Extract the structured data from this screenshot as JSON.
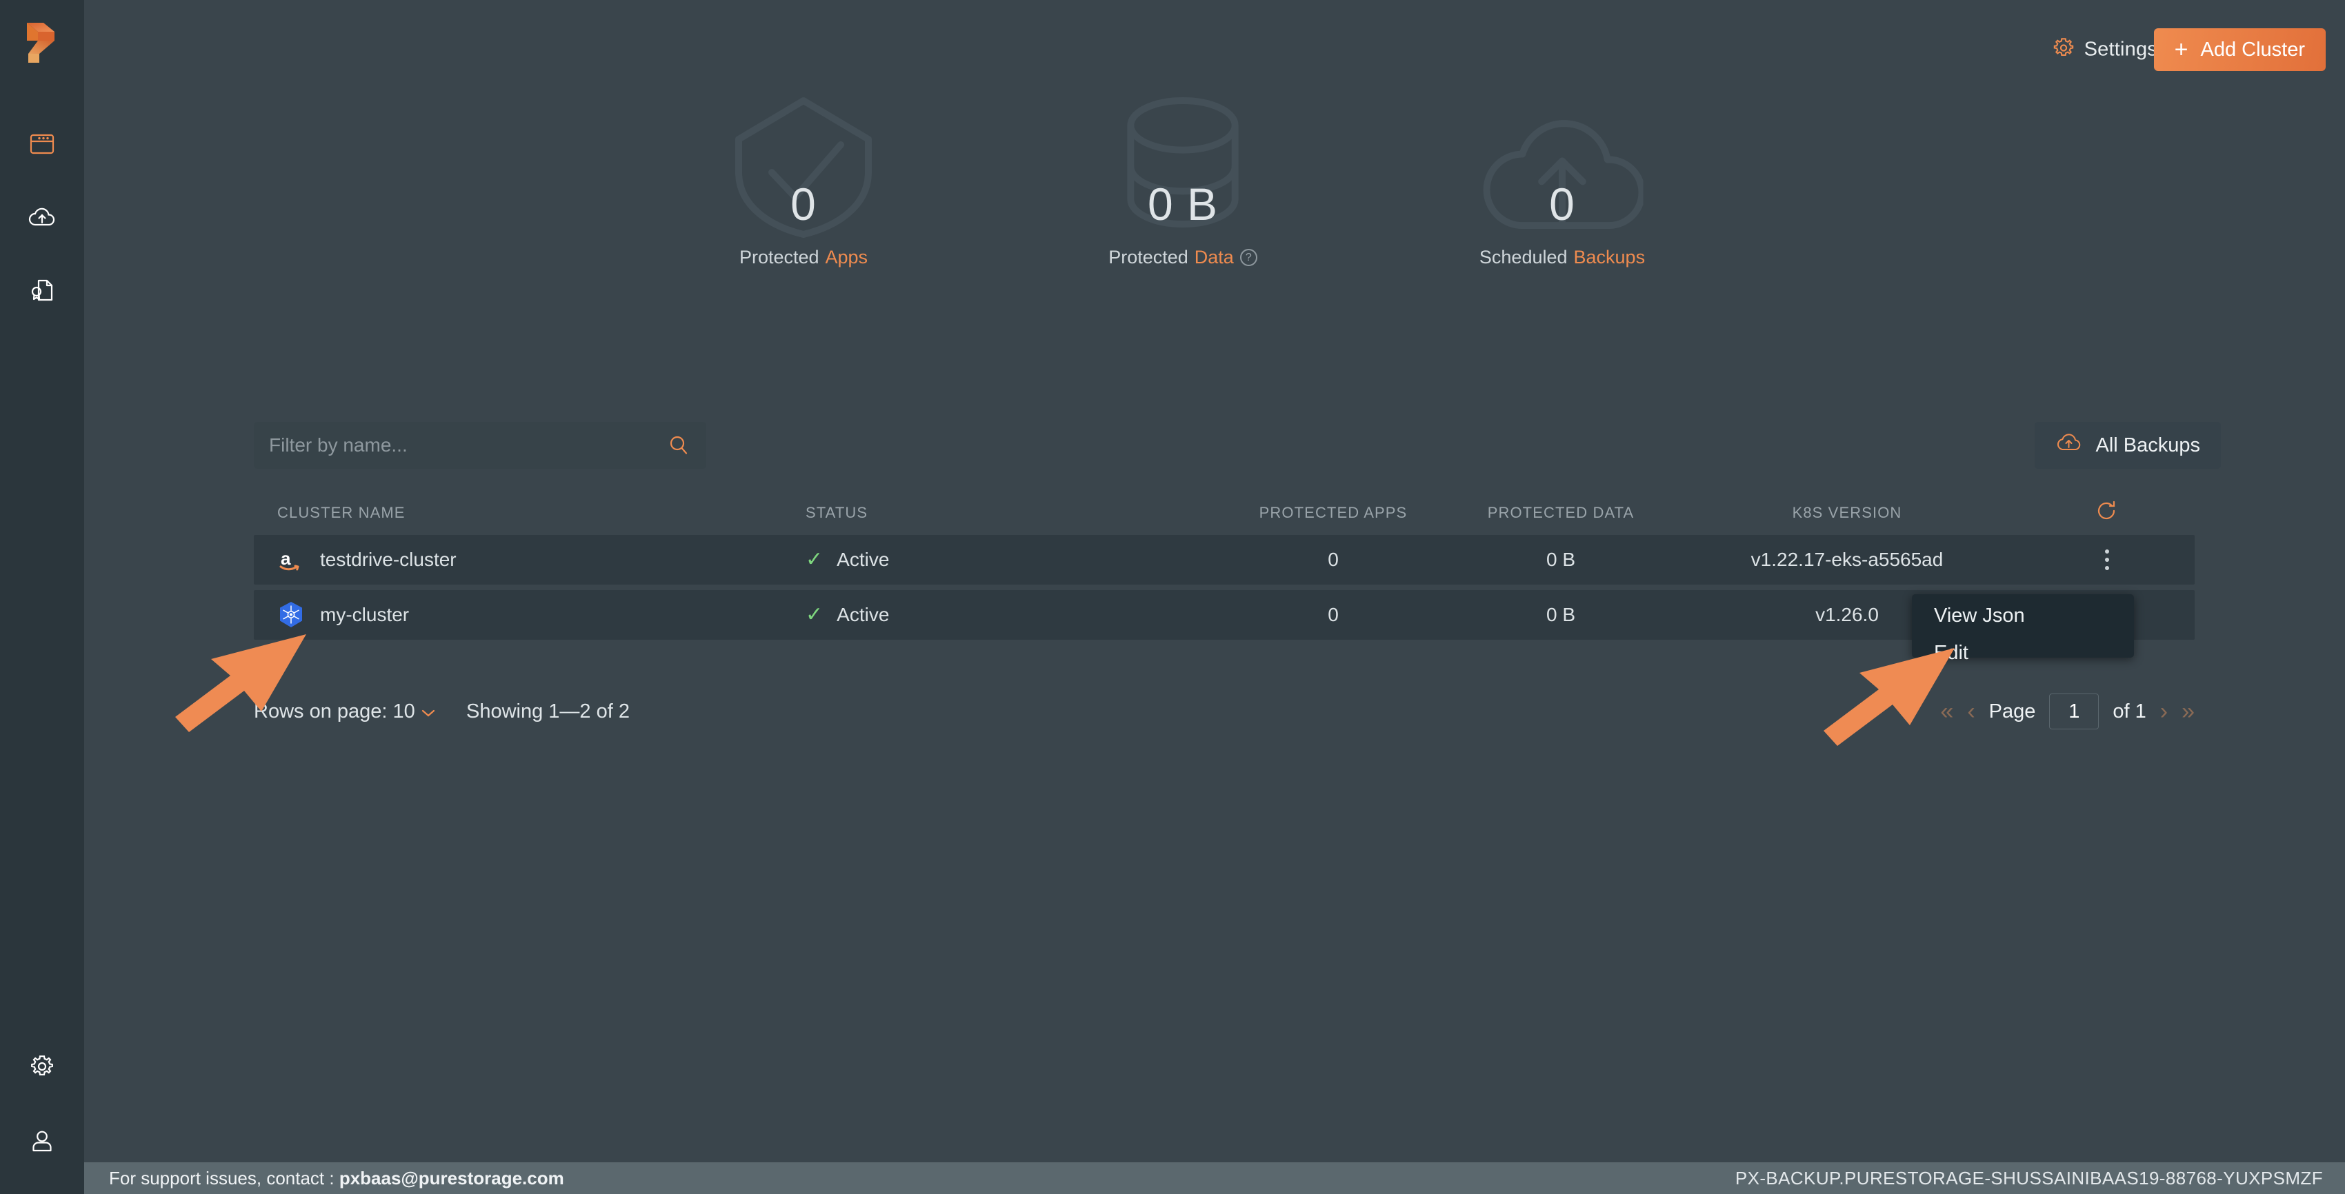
{
  "app": {
    "name": "PX-Backup",
    "logo_icon": "portworx-logo-icon"
  },
  "sidebar": {
    "items": [
      {
        "name": "clusters-icon",
        "label": "Clusters",
        "active": true
      },
      {
        "name": "cloud-upload-icon",
        "label": "Backups",
        "active": false
      },
      {
        "name": "license-document-icon",
        "label": "License",
        "active": false
      }
    ],
    "bottom_items": [
      {
        "name": "gear-icon",
        "label": "Settings"
      },
      {
        "name": "user-icon",
        "label": "Account"
      }
    ]
  },
  "header": {
    "settings_label": "Settings",
    "settings_icon": "gear-icon",
    "settings_chevron": "chevron-down-icon",
    "add_cluster_label": "Add Cluster",
    "add_cluster_plus": "+"
  },
  "stats": [
    {
      "value": "0",
      "label_plain": "Protected",
      "label_highlight": "Apps",
      "watermark": "shield-check-icon",
      "has_help": false
    },
    {
      "value": "0 B",
      "label_plain": "Protected",
      "label_highlight": "Data",
      "watermark": "database-icon",
      "has_help": true,
      "help_glyph": "?"
    },
    {
      "value": "0",
      "label_plain": "Scheduled",
      "label_highlight": "Backups",
      "watermark": "cloud-upload-icon",
      "has_help": false
    }
  ],
  "toolbar": {
    "filter_placeholder": "Filter by name...",
    "filter_value": "",
    "search_icon": "search-icon",
    "all_backups_label": "All Backups",
    "all_backups_icon": "cloud-upload-icon"
  },
  "table": {
    "columns": [
      "CLUSTER NAME",
      "STATUS",
      "PROTECTED APPS",
      "PROTECTED DATA",
      "K8S VERSION"
    ],
    "refresh_icon": "refresh-icon",
    "rows": [
      {
        "provider_icon": "aws-icon",
        "name": "testdrive-cluster",
        "status": "Active",
        "status_icon": "check-icon",
        "protected_apps": "0",
        "protected_data": "0 B",
        "k8s_version": "v1.22.17-eks-a5565ad",
        "menu_icon": "kebab-menu-icon"
      },
      {
        "provider_icon": "kubernetes-icon",
        "name": "my-cluster",
        "status": "Active",
        "status_icon": "check-icon",
        "protected_apps": "0",
        "protected_data": "0 B",
        "k8s_version": "v1.26.0",
        "menu_icon": "kebab-menu-icon"
      }
    ]
  },
  "context_menu": {
    "items": [
      {
        "label": "View Json"
      },
      {
        "label": "Edit"
      }
    ]
  },
  "pagination": {
    "rows_on_page_label": "Rows on page:",
    "rows_on_page_value": "10",
    "rows_chevron": "chevron-down-icon",
    "showing": "Showing 1—2 of 2",
    "page_label": "Page",
    "page_value": "1",
    "of_label": "of 1",
    "first_arrow": "«",
    "prev_arrow": "‹",
    "next_arrow": "›",
    "last_arrow": "»"
  },
  "footer": {
    "support_prefix": "For support issues, contact : ",
    "support_email": "pxbaas@purestorage.com",
    "instance_id": "PX-BACKUP.PURESTORAGE-SHUSSAINIBAAS19-88768-YUXPSMZF"
  },
  "annotations": [
    {
      "name": "arrow-pointing-to-kubernetes-icon"
    },
    {
      "name": "arrow-pointing-to-edit-menu-item"
    }
  ],
  "colors": {
    "accent_orange": "#ef8b4f",
    "sidebar_bg": "#2b363c",
    "main_bg": "#3a454c",
    "row_bg": "#2f3a41",
    "menu_bg": "#1e2a31",
    "footer_bg": "#5b686e",
    "status_green": "#7ed67e",
    "kubernetes_blue": "#326ce5"
  }
}
